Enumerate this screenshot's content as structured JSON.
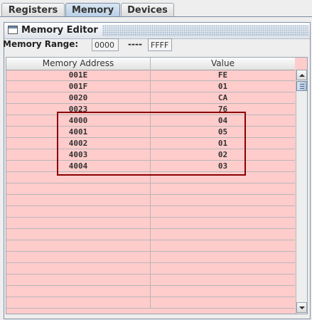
{
  "tabs": [
    {
      "label": "Registers",
      "active": false
    },
    {
      "label": "Memory",
      "active": true
    },
    {
      "label": "Devices",
      "active": false
    }
  ],
  "frame": {
    "title": "Memory Editor"
  },
  "range": {
    "label": "Memory Range:",
    "start": "0000",
    "separator": "----",
    "end": "FFFF"
  },
  "table": {
    "columns": [
      "Memory Address",
      "Value"
    ],
    "rows": [
      {
        "address": "001E",
        "value": "FE"
      },
      {
        "address": "001F",
        "value": "01"
      },
      {
        "address": "0020",
        "value": "CA"
      },
      {
        "address": "0023",
        "value": "76"
      },
      {
        "address": "4000",
        "value": "04"
      },
      {
        "address": "4001",
        "value": "05"
      },
      {
        "address": "4002",
        "value": "01"
      },
      {
        "address": "4003",
        "value": "02"
      },
      {
        "address": "4004",
        "value": "03"
      },
      {
        "address": "",
        "value": ""
      },
      {
        "address": "",
        "value": ""
      },
      {
        "address": "",
        "value": ""
      },
      {
        "address": "",
        "value": ""
      },
      {
        "address": "",
        "value": ""
      },
      {
        "address": "",
        "value": ""
      },
      {
        "address": "",
        "value": ""
      },
      {
        "address": "",
        "value": ""
      },
      {
        "address": "",
        "value": ""
      },
      {
        "address": "",
        "value": ""
      },
      {
        "address": "",
        "value": ""
      },
      {
        "address": "",
        "value": ""
      }
    ]
  },
  "colors": {
    "row_bg": "#ffcccc",
    "highlight": "#8b0000",
    "active_tab": "#b9cfe6"
  }
}
